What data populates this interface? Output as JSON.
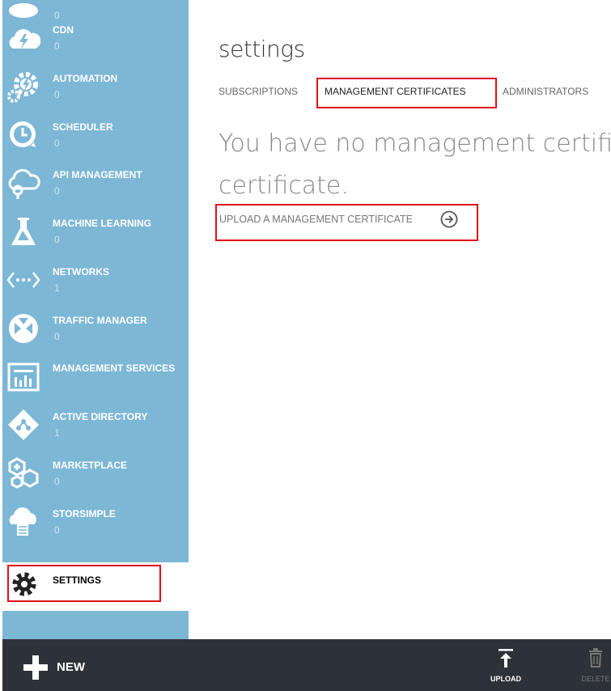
{
  "sidebar": {
    "top_partial": {
      "count": "0"
    },
    "items": [
      {
        "label": "CDN",
        "count": "0",
        "icon": "cdn-cloud-icon"
      },
      {
        "label": "AUTOMATION",
        "count": "0",
        "icon": "automation-gears-icon"
      },
      {
        "label": "SCHEDULER",
        "count": "0",
        "icon": "scheduler-clock-icon"
      },
      {
        "label": "API MANAGEMENT",
        "count": "0",
        "icon": "api-cloud-icon"
      },
      {
        "label": "MACHINE LEARNING",
        "count": "0",
        "icon": "flask-icon"
      },
      {
        "label": "NETWORKS",
        "count": "1",
        "icon": "network-brackets-icon"
      },
      {
        "label": "TRAFFIC MANAGER",
        "count": "0",
        "icon": "traffic-arrows-icon"
      },
      {
        "label": "MANAGEMENT SERVICES",
        "count": "",
        "icon": "management-services-icon"
      },
      {
        "label": "ACTIVE DIRECTORY",
        "count": "1",
        "icon": "diamond-directory-icon"
      },
      {
        "label": "MARKETPLACE",
        "count": "0",
        "icon": "hexagons-icon"
      },
      {
        "label": "STORSIMPLE",
        "count": "0",
        "icon": "storsimple-cloud-icon"
      },
      {
        "label": "SETTINGS",
        "count": "",
        "icon": "gear-icon"
      }
    ]
  },
  "main": {
    "title": "settings",
    "tabs": [
      {
        "label": "SUBSCRIPTIONS"
      },
      {
        "label": "MANAGEMENT CERTIFICATES"
      },
      {
        "label": "ADMINISTRATORS"
      }
    ],
    "empty_line1": "You have no management certifica",
    "empty_line2": "certificate.",
    "upload_link": "UPLOAD A MANAGEMENT CERTIFICATE"
  },
  "bottombar": {
    "new_label": "NEW",
    "upload_label": "UPLOAD",
    "delete_label": "DELETE"
  },
  "colors": {
    "sidebar_bg": "#7db7d6",
    "bottombar_bg": "#2d3238",
    "highlight_red": "#e0101a"
  }
}
